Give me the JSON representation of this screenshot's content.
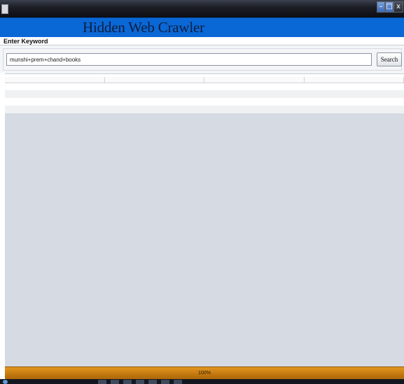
{
  "window": {
    "app_icon": "app-window-icon",
    "minimize_glyph": "–",
    "maximize_glyph": "□",
    "close_glyph": "x"
  },
  "app": {
    "title": "Hidden Web Crawler"
  },
  "search": {
    "label": "Enter Keyword",
    "value": "munshi+prem+chand+books",
    "button_label": "Search"
  },
  "results_table": {
    "columns": [
      "",
      "",
      "",
      ""
    ],
    "rows": 3
  },
  "status": {
    "progress": 1.0,
    "progress_text": "100%",
    "progress_color": "#d1860f"
  },
  "colors": {
    "banner": "#0a67d6",
    "content_background": "#d6dae3"
  }
}
